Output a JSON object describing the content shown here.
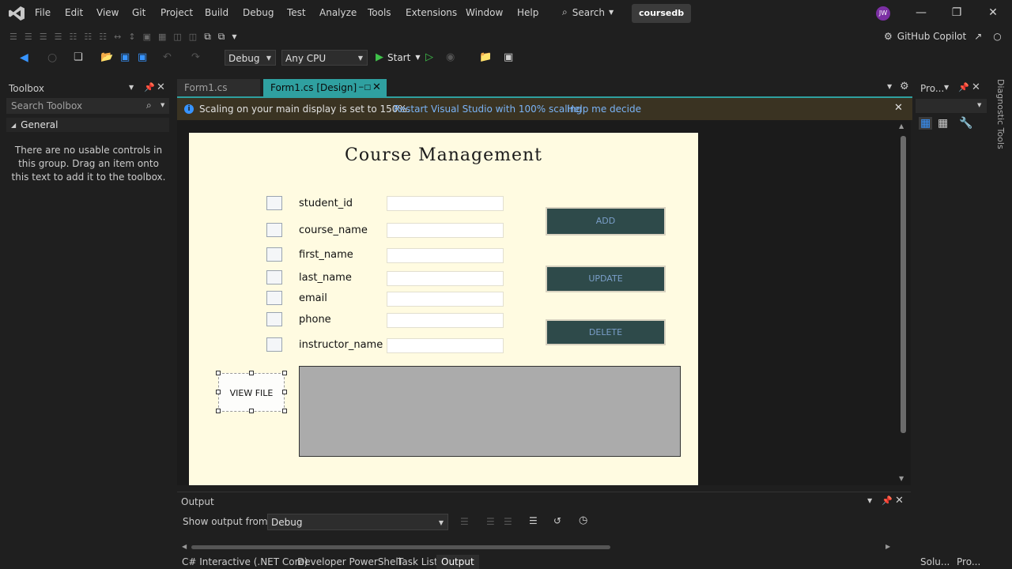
{
  "menu": {
    "items": [
      "File",
      "Edit",
      "View",
      "Git",
      "Project",
      "Build",
      "Debug",
      "Test",
      "Analyze",
      "Tools",
      "Extensions",
      "Window",
      "Help"
    ],
    "search": "Search",
    "solution": "coursedb",
    "user_initials": "JW"
  },
  "toolbar": {
    "config": "Debug",
    "platform": "Any CPU",
    "start_label": "Start",
    "copilot": "GitHub Copilot"
  },
  "toolbox": {
    "title": "Toolbox",
    "search_placeholder": "Search Toolbox",
    "group": "General",
    "empty_text": "There are no usable controls in this group. Drag an item onto this text to add it to the toolbox."
  },
  "tabs": [
    {
      "label": "Form1.cs"
    },
    {
      "label": "Form1.cs [Design]"
    }
  ],
  "infobar": {
    "message": "Scaling on your main display is set to 150%.",
    "link1": "Restart Visual Studio with 100% scaling",
    "link2": "Help me decide"
  },
  "form": {
    "title": "Course Management",
    "fields": [
      {
        "label": "student_id"
      },
      {
        "label": "course_name"
      },
      {
        "label": "first_name"
      },
      {
        "label": "last_name"
      },
      {
        "label": "email"
      },
      {
        "label": "phone"
      },
      {
        "label": "instructor_name"
      }
    ],
    "buttons": {
      "add": "ADD",
      "update": "UPDATE",
      "delete": "DELETE",
      "view_file": "VIEW FILE"
    }
  },
  "right_pane": {
    "title": "Pro...",
    "diagnostic": "Diagnostic Tools"
  },
  "output": {
    "title": "Output",
    "show_from": "Show output from:",
    "source": "Debug"
  },
  "bottom_tabs": [
    "C# Interactive (.NET Core)",
    "Developer PowerShell",
    "Task List",
    "Output"
  ],
  "bottom_right_tabs": [
    "Solu...",
    "Pro..."
  ],
  "colors": {
    "accent": "#2fa0a0",
    "form_bg": "#fffbe1",
    "button_bg": "#2e4a4a"
  }
}
